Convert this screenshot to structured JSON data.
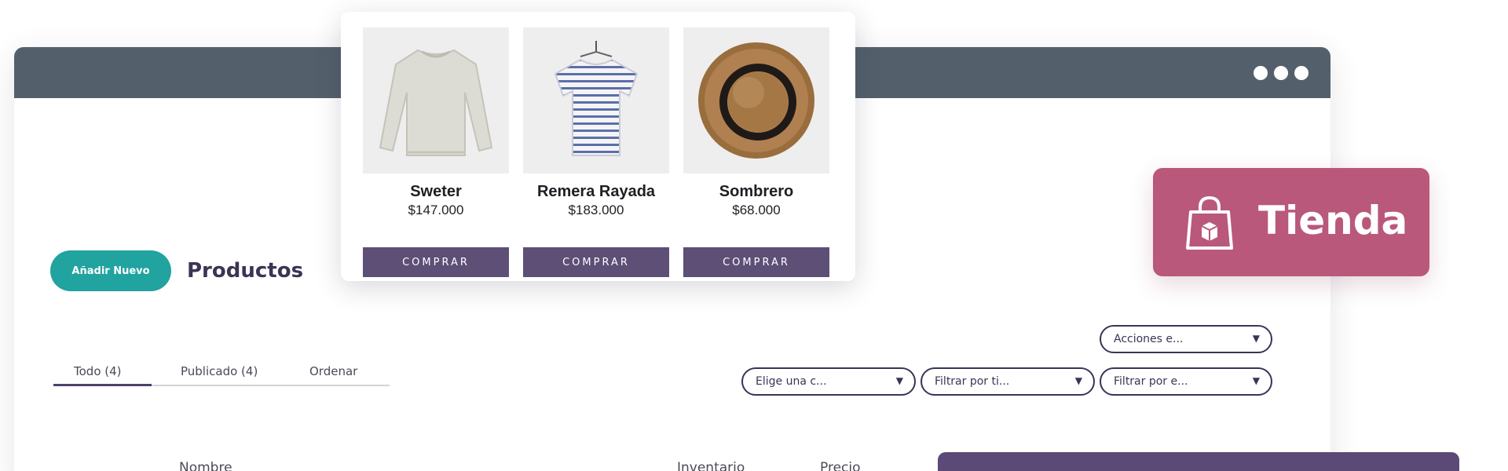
{
  "window": {
    "menu_icon": "three-dots-icon"
  },
  "header": {
    "add_button": "Añadir Nuevo",
    "title": "Productos"
  },
  "tabs": [
    {
      "label": "Todo (4)",
      "active": true
    },
    {
      "label": "Publicado (4)",
      "active": false
    },
    {
      "label": "Ordenar",
      "active": false
    }
  ],
  "filters": {
    "bulk_actions": "Acciones e...",
    "category": "Elige una c...",
    "type": "Filtrar por ti...",
    "stock": "Filtrar por e..."
  },
  "table": {
    "columns": [
      "Nombre",
      "Inventario",
      "Precio"
    ]
  },
  "popup": {
    "products": [
      {
        "name": "Sweter",
        "price": "$147.000",
        "button": "COMPRAR",
        "image": "sweater-image"
      },
      {
        "name": "Remera Rayada",
        "price": "$183.000",
        "button": "COMPRAR",
        "image": "striped-tshirt-image"
      },
      {
        "name": "Sombrero",
        "price": "$68.000",
        "button": "COMPRAR",
        "image": "straw-hat-image"
      }
    ]
  },
  "badge": {
    "label": "Tienda",
    "icon": "shopping-bag-icon"
  },
  "colors": {
    "titlebar": "#53606c",
    "accent_teal": "#21a3a0",
    "brand_purple": "#5d4f76",
    "badge_pink": "#b9587a"
  }
}
